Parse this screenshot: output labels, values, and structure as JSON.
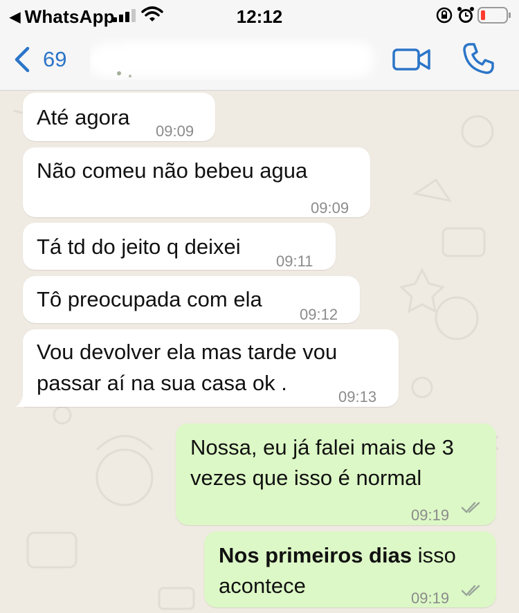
{
  "status_bar": {
    "back_app": "WhatsApp",
    "time": "12:12"
  },
  "header": {
    "back_count": "69",
    "icons": [
      "chevron-left-icon",
      "video-call-icon",
      "phone-icon"
    ],
    "accent_color": "#2b75c8"
  },
  "messages": [
    {
      "direction": "incoming",
      "text": "Até agora",
      "time": "09:09"
    },
    {
      "direction": "incoming",
      "text": "Não comeu não bebeu agua",
      "time": "09:09"
    },
    {
      "direction": "incoming",
      "text": "Tá td do jeito q deixei",
      "time": "09:11"
    },
    {
      "direction": "incoming",
      "text": "Tô preocupada com ela",
      "time": "09:12"
    },
    {
      "direction": "incoming",
      "line1": "Vou devolver ela mas tarde vou",
      "line2": "passar aí na sua casa ok .",
      "time": "09:13"
    },
    {
      "direction": "outgoing",
      "line1": "Nossa, eu já falei mais de 3",
      "line2": "vezes que isso é normal",
      "time": "09:19"
    },
    {
      "direction": "outgoing",
      "bold_part": "Nos primeiros dias",
      "rest": " isso",
      "line2": "acontece",
      "time": "09:19"
    }
  ],
  "colors": {
    "background": "#efeae2",
    "incoming_bubble": "#ffffff",
    "outgoing_bubble": "#dcf8c6",
    "timestamp": "#8b8b8b"
  }
}
